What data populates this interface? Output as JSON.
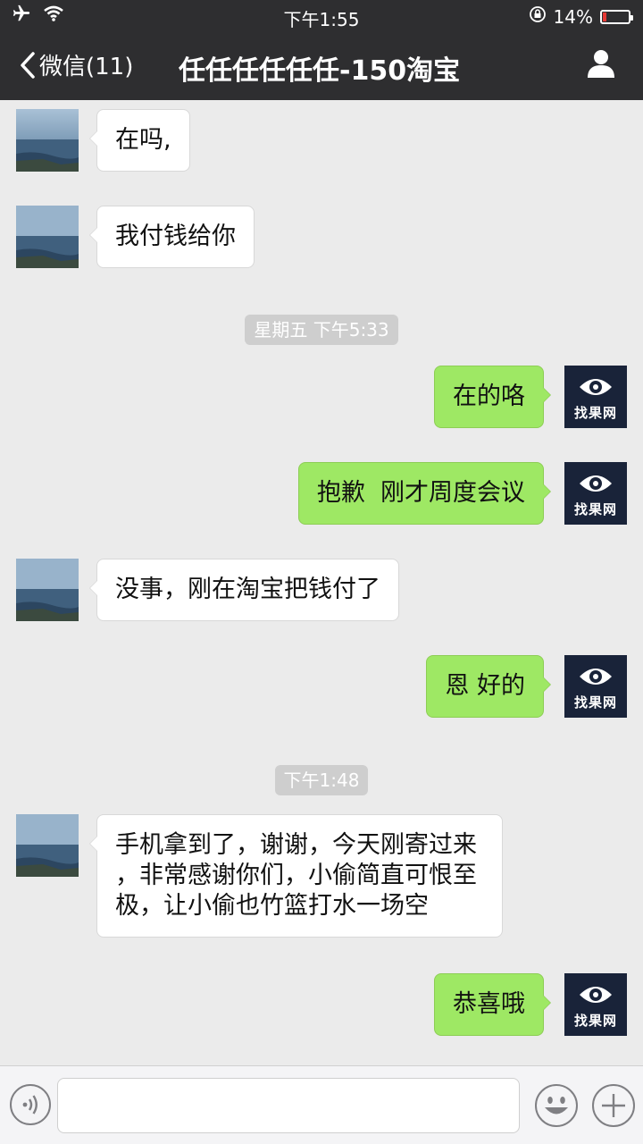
{
  "status_bar": {
    "time": "下午1:55",
    "battery": "14%",
    "battery_level": 0.14
  },
  "nav": {
    "back_label": "微信(11)",
    "title": "任任任任任任-150淘宝"
  },
  "avatars": {
    "self_logo_text": "找果网"
  },
  "messages": [
    {
      "side": "in",
      "text": "在吗,"
    },
    {
      "side": "in",
      "text": "我付钱给你"
    },
    {
      "type": "time",
      "text": "星期五 下午5:33"
    },
    {
      "side": "out",
      "text": "在的咯"
    },
    {
      "side": "out",
      "text": "抱歉  刚才周度会议"
    },
    {
      "side": "in",
      "text": "没事，刚在淘宝把钱付了"
    },
    {
      "side": "out",
      "text": "恩 好的"
    },
    {
      "type": "time",
      "text": "下午1:48"
    },
    {
      "side": "in",
      "lines": [
        "手机拿到了，谢谢，今天刚寄过来",
        "，非常感谢你们，小偷简直可恨至",
        "极，让小偷也竹篮打水一场空"
      ]
    },
    {
      "side": "out",
      "text": "恭喜哦"
    }
  ],
  "input_bar": {
    "voice_icon": "voice-icon",
    "emoji_icon": "emoji-icon",
    "plus_icon": "plus-icon",
    "input_value": ""
  },
  "colors": {
    "nav_bg": "#2e2e30",
    "chat_bg": "#ebebeb",
    "outgoing_bubble": "#9ee864",
    "incoming_bubble": "#ffffff",
    "battery_red": "#e53935"
  }
}
